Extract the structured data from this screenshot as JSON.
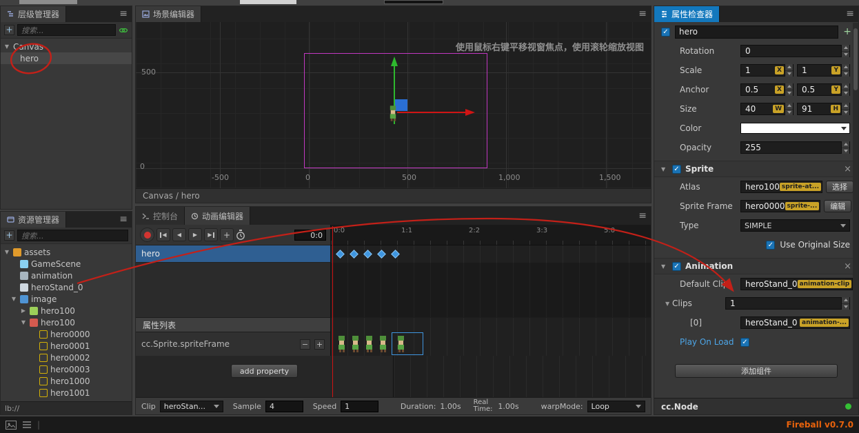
{
  "app": {
    "version_label": "Fireball v0.7.0",
    "status_protocol": "lb://"
  },
  "icons": {
    "menu": "≡",
    "collapse": "▼",
    "expand": "▶",
    "check": "✓",
    "close": "×",
    "plus": "+",
    "minus": "−",
    "prev": "◀",
    "play": "▶",
    "divider": "|"
  },
  "hierarchy": {
    "tab": "层级管理器",
    "search_placeholder": "搜索...",
    "nodes": [
      {
        "label": "Canvas"
      },
      {
        "label": "hero"
      }
    ]
  },
  "assets": {
    "tab": "资源管理器",
    "search_placeholder": "搜索...",
    "items": [
      {
        "label": "assets",
        "icon": "assets-root-icon"
      },
      {
        "label": "GameScene",
        "icon": "scene-asset-icon"
      },
      {
        "label": "animation",
        "icon": "animation-folder-icon"
      },
      {
        "label": "heroStand_0",
        "icon": "animation-clip-icon"
      },
      {
        "label": "image",
        "icon": "folder-icon"
      },
      {
        "label": "hero100",
        "icon": "atlas-icon"
      },
      {
        "label": "hero100",
        "icon": "texture-icon"
      },
      {
        "label": "hero0000",
        "icon": "sprite-frame-icon"
      },
      {
        "label": "hero0001",
        "icon": "sprite-frame-icon"
      },
      {
        "label": "hero0002",
        "icon": "sprite-frame-icon"
      },
      {
        "label": "hero0003",
        "icon": "sprite-frame-icon"
      },
      {
        "label": "hero1000",
        "icon": "sprite-frame-icon"
      },
      {
        "label": "hero1001",
        "icon": "sprite-frame-icon"
      }
    ]
  },
  "scene": {
    "tab": "场景编辑器",
    "hint": "使用鼠标右键平移视窗焦点，使用滚轮缩放视图",
    "breadcrumb": "Canvas / hero",
    "y_axis_labels": [
      "500",
      "0"
    ],
    "x_axis_labels": [
      "-500",
      "0",
      "500",
      "1,000",
      "1,500"
    ]
  },
  "animation": {
    "tabs": [
      {
        "label": "控制台"
      },
      {
        "label": "动画编辑器"
      }
    ],
    "time_display": "0:0",
    "ruler_labels": [
      "0:0",
      "1:1",
      "2:2",
      "3:3",
      "5:0"
    ],
    "track_name": "hero",
    "property_list_title": "属性列表",
    "property_name": "cc.Sprite.spriteFrame",
    "add_property_label": "add property",
    "footer": {
      "clip_label": "Clip",
      "clip_value": "heroStan...",
      "sample_label": "Sample",
      "sample_value": "4",
      "speed_label": "Speed",
      "speed_value": "1",
      "duration_label": "Duration:",
      "duration_value": "1.00s",
      "real_time_label": "Real Time:",
      "real_time_value": "1.00s",
      "warp_label": "warpMode:",
      "warp_value": "Loop"
    }
  },
  "inspector": {
    "tab": "属性检查器",
    "node_name": "hero",
    "rows": {
      "rotation": {
        "label": "Rotation",
        "value": "0"
      },
      "scale": {
        "label": "Scale",
        "x": "1",
        "y": "1"
      },
      "anchor": {
        "label": "Anchor",
        "x": "0.5",
        "y": "0.5"
      },
      "size": {
        "label": "Size",
        "w": "40",
        "h": "91"
      },
      "color": {
        "label": "Color"
      },
      "opacity": {
        "label": "Opacity",
        "value": "255"
      }
    },
    "axis_badges": {
      "x": "X",
      "y": "Y",
      "w": "W",
      "h": "H"
    },
    "sprite_section": {
      "title": "Sprite",
      "atlas_label": "Atlas",
      "atlas_value": "hero100",
      "atlas_badge": "sprite-at...",
      "atlas_button": "选择",
      "frame_label": "Sprite Frame",
      "frame_value": "hero0000",
      "frame_badge": "sprite-...",
      "frame_button": "编辑",
      "type_label": "Type",
      "type_value": "SIMPLE",
      "use_original_size_label": "Use Original Size"
    },
    "animation_section": {
      "title": "Animation",
      "default_clip_label": "Default Clip",
      "default_clip_value": "heroStand_0",
      "default_clip_badge": "animation-clip",
      "clips_label": "Clips",
      "clips_value": "1",
      "element0_label": "[0]",
      "element0_value": "heroStand_0",
      "element0_badge": "animation-...",
      "play_on_load_label": "Play On Load"
    },
    "add_component_label": "添加组件",
    "footer_component": "cc.Node"
  }
}
